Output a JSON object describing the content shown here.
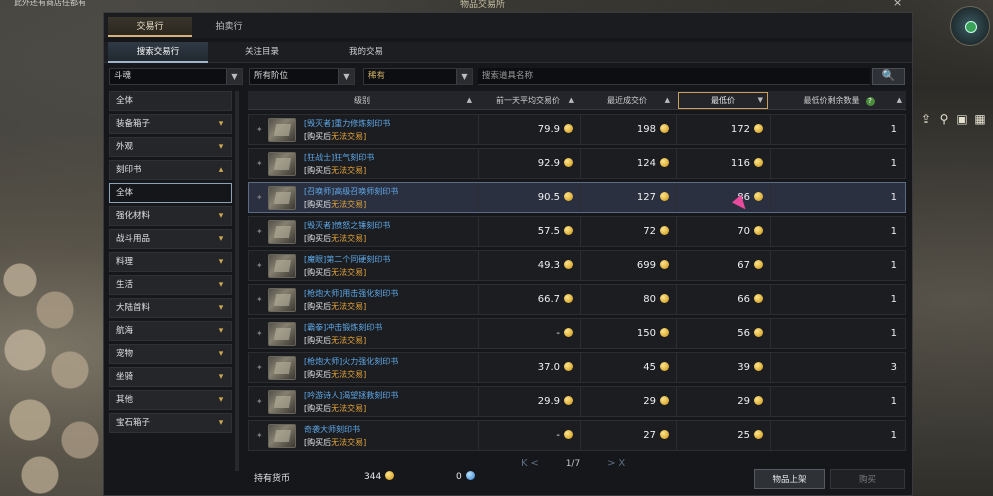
{
  "window": {
    "caption": "此外还有商店任都有",
    "title": "物品交易所",
    "close": "×"
  },
  "main_tabs": [
    {
      "label": "交易行",
      "active": true
    },
    {
      "label": "拍卖行",
      "active": false
    }
  ],
  "sub_tabs": [
    {
      "label": "搜索交易行",
      "active": true
    },
    {
      "label": "关注目录",
      "active": false
    },
    {
      "label": "我的交易",
      "active": false
    }
  ],
  "filters": {
    "class_select": "斗魂",
    "tier_select": "所有阶位",
    "grade_select": "稀有",
    "search_placeholder": "搜索道具名称",
    "search_icon": "🔍"
  },
  "categories": [
    {
      "label": "全体",
      "type": "top",
      "chevron": ""
    },
    {
      "label": "装备箱子",
      "type": "top",
      "chevron": "▾"
    },
    {
      "label": "外观",
      "type": "top",
      "chevron": "▾"
    },
    {
      "label": "刻印书",
      "type": "top",
      "chevron": "▴"
    },
    {
      "label": "全体",
      "type": "selected",
      "chevron": ""
    },
    {
      "label": "强化材料",
      "type": "top",
      "chevron": "▾"
    },
    {
      "label": "战斗用品",
      "type": "top",
      "chevron": "▾"
    },
    {
      "label": "料理",
      "type": "top",
      "chevron": "▾"
    },
    {
      "label": "生活",
      "type": "top",
      "chevron": "▾"
    },
    {
      "label": "大陆首料",
      "type": "top",
      "chevron": "▾"
    },
    {
      "label": "航海",
      "type": "top",
      "chevron": "▾"
    },
    {
      "label": "宠物",
      "type": "top",
      "chevron": "▾"
    },
    {
      "label": "坐骑",
      "type": "top",
      "chevron": "▾"
    },
    {
      "label": "其他",
      "type": "top",
      "chevron": "▾"
    },
    {
      "label": "宝石箱子",
      "type": "top",
      "chevron": "▾"
    }
  ],
  "table": {
    "headers": {
      "grade": "级别",
      "avg_price": "前一天平均交易价",
      "recent_price": "最近成交价",
      "min_price": "最低价",
      "min_qty": "最低价剩余数量"
    },
    "help_icon": "?",
    "rows": [
      {
        "name": "[毁灭者]重力修炼刻印书",
        "note": "[购买后",
        "warn": "无法交易]",
        "avg": "79.9",
        "recent": "198",
        "min": "172",
        "qty": "1"
      },
      {
        "name": "[狂战士]狂气刻印书",
        "note": "[购买后",
        "warn": "无法交易]",
        "avg": "92.9",
        "recent": "124",
        "min": "116",
        "qty": "1"
      },
      {
        "name": "[召唤师]高级召唤师刻印书",
        "note": "[购买后",
        "warn": "无法交易]",
        "avg": "90.5",
        "recent": "127",
        "min": "86",
        "qty": "1",
        "highlight": true
      },
      {
        "name": "[毁灭者]愤怒之锤刻印书",
        "note": "[购买后",
        "warn": "无法交易]",
        "avg": "57.5",
        "recent": "72",
        "min": "70",
        "qty": "1"
      },
      {
        "name": "[魔眼]第二个同硬刻印书",
        "note": "[购买后",
        "warn": "无法交易]",
        "avg": "49.3",
        "recent": "699",
        "min": "67",
        "qty": "1"
      },
      {
        "name": "[枪炮大师]用击强化刻印书",
        "note": "[购买后",
        "warn": "无法交易]",
        "avg": "66.7",
        "recent": "80",
        "min": "66",
        "qty": "1"
      },
      {
        "name": "[霸拳]冲击锻炼刻印书",
        "note": "[购买后",
        "warn": "无法交易]",
        "avg": "-",
        "recent": "150",
        "min": "56",
        "qty": "1"
      },
      {
        "name": "[枪炮大师]火力强化刻印书",
        "note": "[购买后",
        "warn": "无法交易]",
        "avg": "37.0",
        "recent": "45",
        "min": "39",
        "qty": "3"
      },
      {
        "name": "[吟游诗人]渴望拯救刻印书",
        "note": "[购买后",
        "warn": "无法交易]",
        "avg": "29.9",
        "recent": "29",
        "min": "29",
        "qty": "1"
      },
      {
        "name": "奇袭大师刻印书",
        "note": "[购买后",
        "warn": "无法交易]",
        "avg": "-",
        "recent": "27",
        "min": "25",
        "qty": "1"
      }
    ]
  },
  "pager": {
    "first": "K",
    "prev": "<",
    "page_text": "1/7",
    "next": ">",
    "last": "X"
  },
  "footer": {
    "currency_label": "持有货币",
    "gold_amount": "344",
    "blue_amount": "0",
    "list_button": "物品上架",
    "buy_button": "购买"
  },
  "colors": {
    "item_name": "#5fa9e8",
    "warn": "#e4a43a",
    "gold_coin": "#e2b23a",
    "selected_border": "#c8a25a",
    "cursor": "#e94a9b"
  }
}
